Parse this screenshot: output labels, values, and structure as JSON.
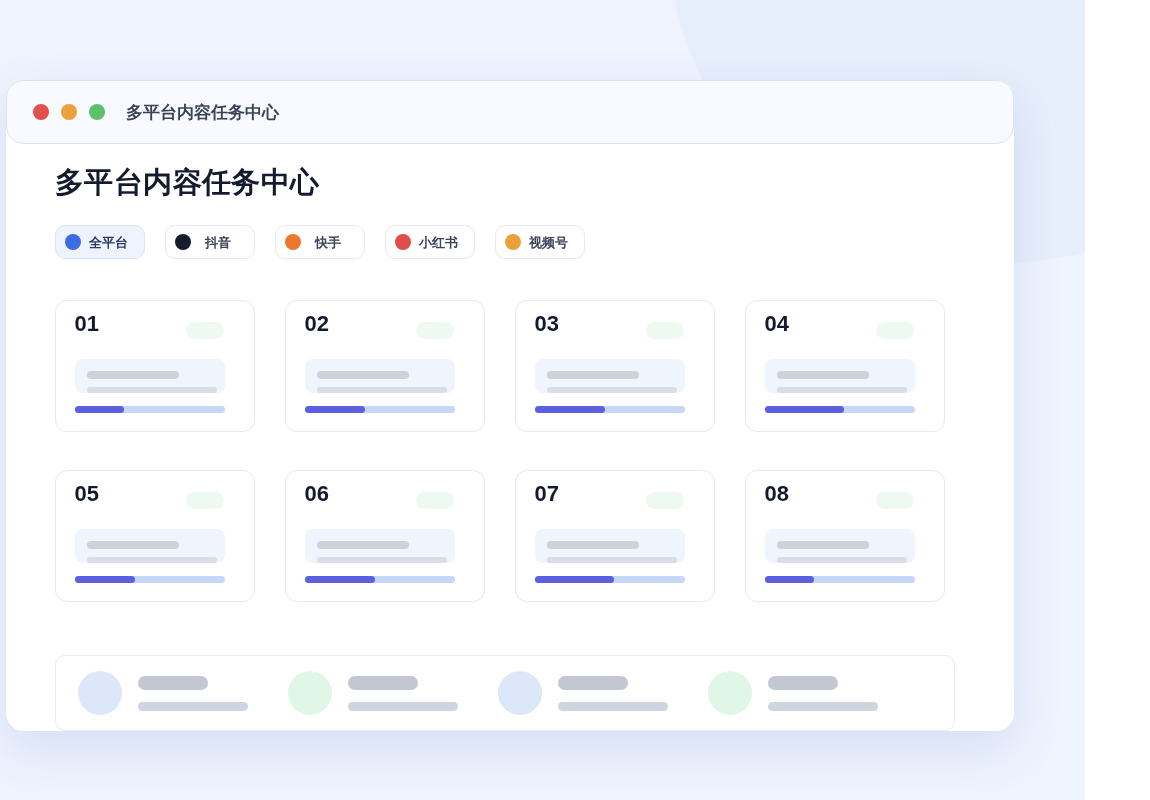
{
  "window": {
    "title": "多平台内容任务中心",
    "controls": [
      {
        "color": "#e0514d"
      },
      {
        "color": "#eba13b"
      },
      {
        "color": "#5bc16c"
      }
    ]
  },
  "heading": "多平台内容任务中心",
  "platforms": [
    {
      "label": "全平台",
      "color": "#3c6be6",
      "selected": true
    },
    {
      "label": "抖音",
      "color": "#161b2d",
      "selected": false
    },
    {
      "label": "快手",
      "color": "#ee7730",
      "selected": false
    },
    {
      "label": "小红书",
      "color": "#df4e4b",
      "selected": false
    },
    {
      "label": "视频号",
      "color": "#eca03a",
      "selected": false
    }
  ],
  "cards": [
    {
      "number": "01",
      "level": 0.33
    },
    {
      "number": "02",
      "level": 0.4
    },
    {
      "number": "03",
      "level": 0.47
    },
    {
      "number": "04",
      "level": 0.53
    },
    {
      "number": "05",
      "level": 0.4
    },
    {
      "number": "06",
      "level": 0.47
    },
    {
      "number": "07",
      "level": 0.53
    },
    {
      "number": "08",
      "level": 0.33
    }
  ],
  "summary": {
    "items": [
      {
        "color": "#dde7fa"
      },
      {
        "color": "#e0f7e7"
      },
      {
        "color": "#dde7fa"
      },
      {
        "color": "#e0f7e7"
      }
    ]
  }
}
